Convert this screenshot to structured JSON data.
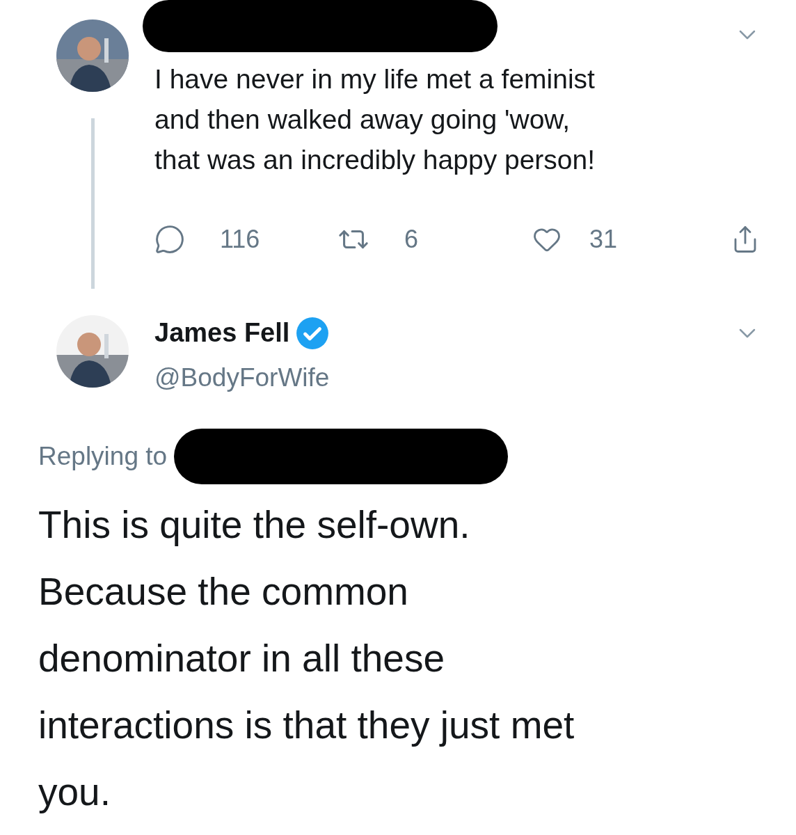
{
  "tweets": [
    {
      "text": "I have never in my life met a feminist\nand then walked away going 'wow,\nthat was an incredibly happy person!",
      "replies": "116",
      "retweets": "6",
      "likes": "31"
    },
    {
      "name": "James Fell",
      "verified": true,
      "handle": "@BodyForWife",
      "replying_to": "Replying to",
      "text": "This is quite the self-own.\nBecause the common\ndenominator in all these\ninteractions is that they just met\nyou."
    }
  ]
}
